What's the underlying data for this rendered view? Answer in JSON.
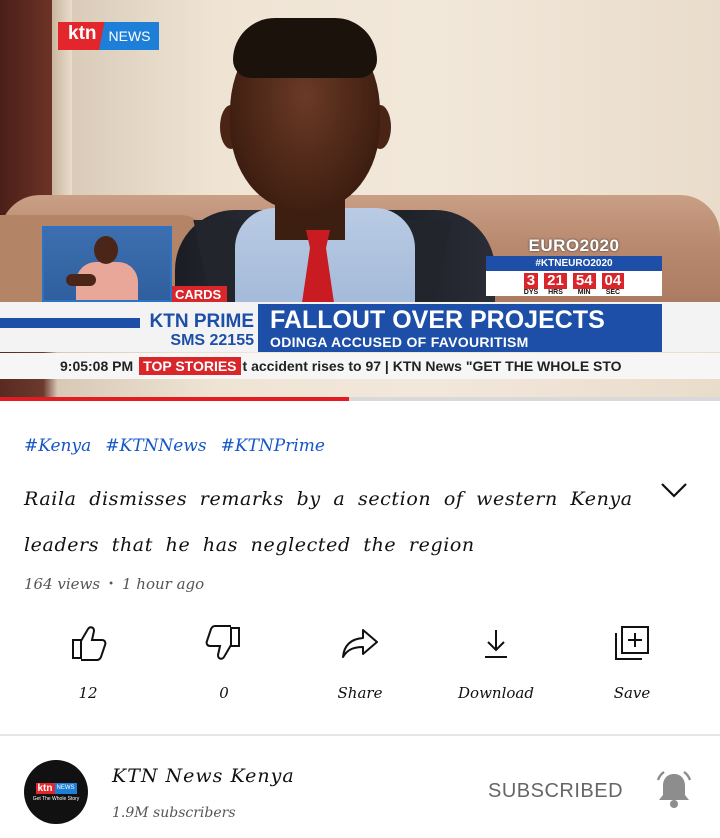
{
  "video": {
    "logo": {
      "brand": "ktn",
      "product": "NEWS"
    },
    "countdown": {
      "title": "EURO2020",
      "hashtag": "#KTNEURO2020",
      "cells": [
        {
          "value": "3",
          "unit": "DYS"
        },
        {
          "value": "21",
          "unit": "HRS"
        },
        {
          "value": "54",
          "unit": "MIN"
        },
        {
          "value": "04",
          "unit": "SEC"
        }
      ]
    },
    "cards_tag": "CARDS",
    "program": {
      "name": "KTN PRIME",
      "sms": "SMS 22155"
    },
    "headline": "FALLOUT OVER PROJECTS",
    "subheadline": "ODINGA ACCUSED OF FAVOURITISM",
    "ticker": {
      "time": "9:05:08 PM",
      "tag": "TOP STORIES",
      "text": "t accident rises to 97  |  KTN News \"GET THE WHOLE STO"
    },
    "progress": 0.485,
    "colors": {
      "accent_red": "#e31b23",
      "ktn_blue": "#1d4fa8"
    }
  },
  "hashtags": [
    "#Kenya",
    "#KTNNews",
    "#KTNPrime"
  ],
  "title": "Raila dismisses remarks by a section of western Kenya leaders that he has neglected the region",
  "meta": {
    "views": "164 views",
    "separator": "•",
    "age": "1 hour ago"
  },
  "actions": [
    {
      "icon": "thumbs-up-icon",
      "label": "12"
    },
    {
      "icon": "thumbs-down-icon",
      "label": "0"
    },
    {
      "icon": "share-icon",
      "label": "Share"
    },
    {
      "icon": "download-icon",
      "label": "Download"
    },
    {
      "icon": "save-icon",
      "label": "Save"
    }
  ],
  "channel": {
    "avatar": {
      "brand": "ktn",
      "product": "NEWS",
      "tagline": "Get The Whole Story"
    },
    "name": "KTN News Kenya",
    "subscribers": "1.9M subscribers",
    "subscribe_label": "SUBSCRIBED",
    "bell_icon": "bell-icon"
  }
}
